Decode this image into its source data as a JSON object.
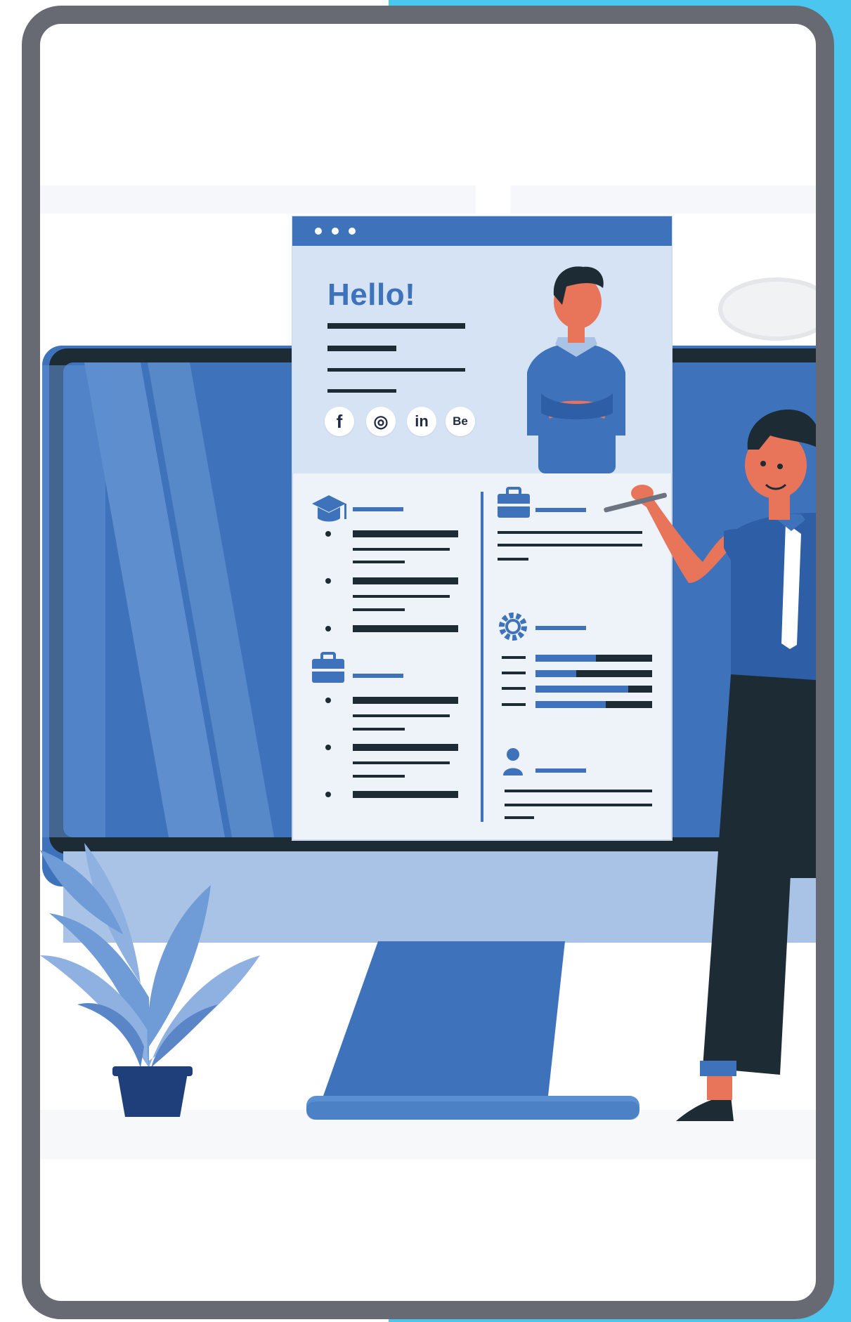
{
  "colors": {
    "accent_strip": "#4bc6ee",
    "frame_border": "#676a73",
    "frame_background": "#ffffff",
    "primary_blue": "#3e73bb",
    "light_blue": "#a9c3e6",
    "pale_blue": "#d6e3f4",
    "dark_navy": "#1d2b34",
    "skin": "#e8745a"
  },
  "resume": {
    "greeting": "Hello!",
    "social_icons": [
      {
        "name": "facebook-icon",
        "glyph": "f"
      },
      {
        "name": "instagram-icon",
        "glyph": "◎"
      },
      {
        "name": "linkedin-icon",
        "glyph": "in"
      },
      {
        "name": "behance-icon",
        "glyph": "Be"
      }
    ]
  }
}
